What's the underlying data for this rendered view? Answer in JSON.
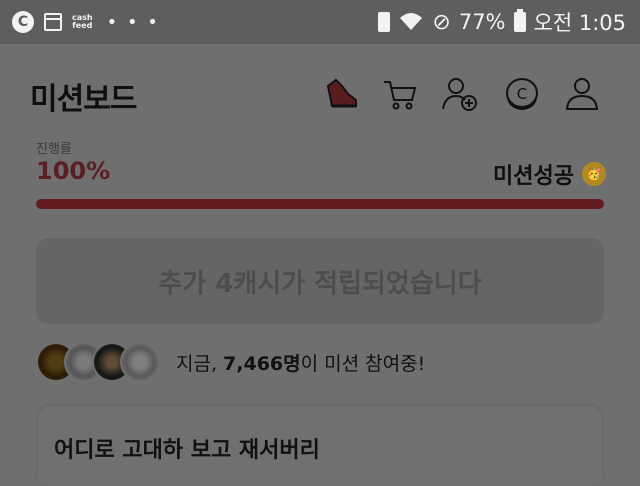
{
  "status_bar": {
    "app_icon_letter": "C",
    "cashfeed_top": "cash",
    "cashfeed_bottom": "feed",
    "more": "• • •",
    "battery_percent": "77%",
    "time": "오전 1:05"
  },
  "header": {
    "title": "미션보드",
    "icons": [
      "shoe-icon",
      "cart-icon",
      "add-friend-icon",
      "coin-icon",
      "profile-icon"
    ]
  },
  "progress": {
    "label": "진행률",
    "value_text": "100%",
    "fraction": 1.0,
    "status": "미션성공",
    "status_emoji": "🥳",
    "fill_color": "#621a1f"
  },
  "banner": {
    "text": "추가 4캐시가 적립되었습니다"
  },
  "participants": {
    "prefix": "지금, ",
    "count": "7,466명",
    "suffix": "이 미션 참여중!"
  },
  "card": {
    "title": "어디로 고대하 보고 재서버리"
  }
}
